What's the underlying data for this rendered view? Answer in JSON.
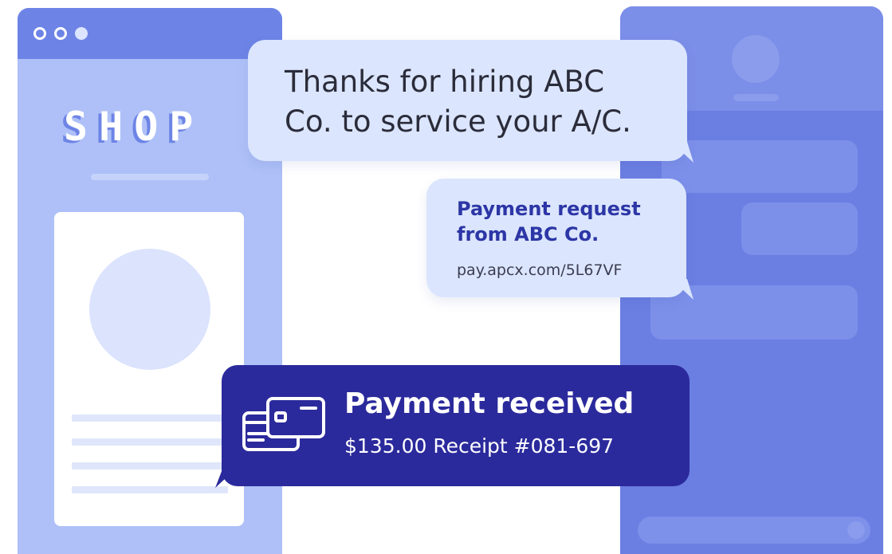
{
  "shop": {
    "logo": "SHOP"
  },
  "messages": {
    "thanks": {
      "line1": "Thanks for hiring ABC",
      "line2": "Co. to service your A/C."
    },
    "payment_request": {
      "title_line1": "Payment request",
      "title_line2": "from ABC Co.",
      "link": "pay.apcx.com/5L67VF"
    },
    "payment_received": {
      "title": "Payment received",
      "detail": "$135.00 Receipt #081-697",
      "icon": "credit-cards-icon"
    }
  },
  "colors": {
    "accent_dark": "#2b2a9c",
    "bubble_light": "#dbe5fd",
    "phone": "#6b7ee2",
    "shop_window": "#aec0f7",
    "link_title": "#2c36a6"
  }
}
